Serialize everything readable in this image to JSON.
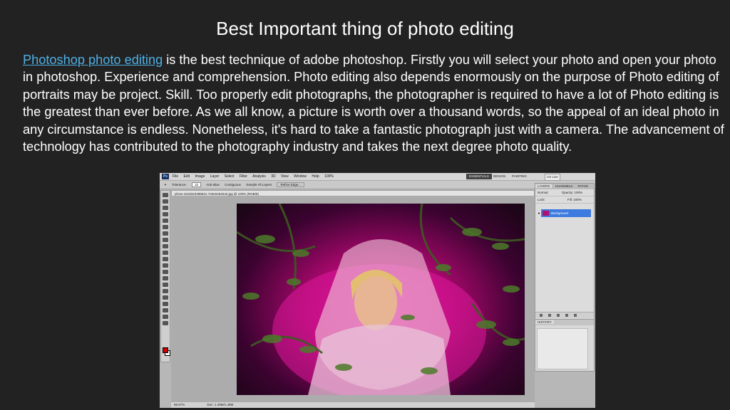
{
  "slide": {
    "title": "Best Important thing of photo editing",
    "link_text": "Photoshop photo editing",
    "body_text": " is the best technique of adobe photoshop. Firstly you will select your photo and open your photo in photoshop. Experience and comprehension. Photo editing also depends enormously on the purpose of Photo editing of portraits may be project. Skill. Too properly edit photographs, the photographer is required to have a lot of Photo editing is the greatest than ever before. As we all know, a picture is worth over a thousand words, so the appeal of an ideal photo in any circumstance is endless. Nonetheless, it's hard to take a fantastic photograph just with a camera. The advancement of technology has contributed to the photography industry and takes the next degree photo quality."
  },
  "colors": {
    "background": "#222222",
    "text": "#ffffff",
    "link": "#4fb0e6",
    "photo_backdrop": "#d1148f"
  },
  "photoshop": {
    "app_badge": "Ps",
    "menus": [
      "File",
      "Edit",
      "Image",
      "Layer",
      "Select",
      "Filter",
      "Analysis",
      "3D",
      "View",
      "Window",
      "Help"
    ],
    "zoom": "100%",
    "workspaces": [
      "ESSENTIALS",
      "DESIGN",
      "PAINTING"
    ],
    "cs_live": "CS Live",
    "options": {
      "tolerance_label": "Tolerance:",
      "tolerance_value": "32",
      "anti_alias": "Anti-alias",
      "contiguous": "Contiguous",
      "sample_all": "Sample All Layers",
      "refine": "Refine Edge..."
    },
    "document_tab": "photo-1618323388631-720e0452643.jpg @ 100% (RGB/8)",
    "status_zoom": "66.67%",
    "status_doc": "Doc: 1.49M/1.49M",
    "panel": {
      "tabs": [
        "LAYERS",
        "CHANNELS",
        "PATHS"
      ],
      "blend_mode": "Normal",
      "opacity": "Opacity: 100%",
      "lock": "Lock:",
      "fill": "Fill: 100%",
      "layer_name": "Background",
      "history_tab": "HISTORY"
    },
    "icons": [
      "magic-wand-icon",
      "eye-icon",
      "lock-icon"
    ]
  }
}
